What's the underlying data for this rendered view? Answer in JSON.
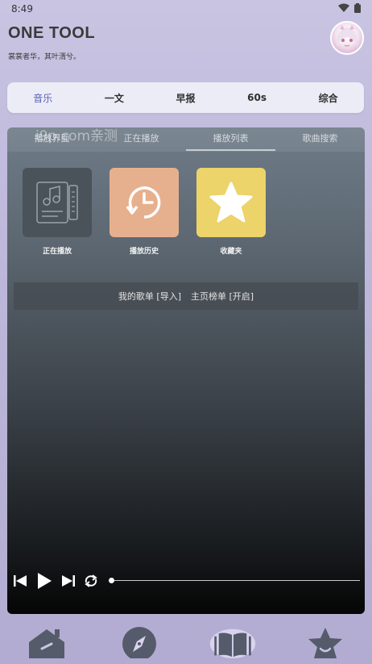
{
  "status": {
    "time": "8:49",
    "icons": [
      "wifi-icon",
      "battery-icon"
    ]
  },
  "header": {
    "title": "ONE TOOL",
    "subtitle": "裳裳者华，其叶湑兮。",
    "avatar_icon": "avatar-anime-girl"
  },
  "top_tabs": [
    {
      "label": "音乐",
      "active": true
    },
    {
      "label": "一文",
      "active": false
    },
    {
      "label": "早报",
      "active": false
    },
    {
      "label": "60s",
      "active": false
    },
    {
      "label": "综合",
      "active": false
    }
  ],
  "sub_tabs": [
    {
      "label": "播放界面",
      "active": false
    },
    {
      "label": "正在播放",
      "active": false
    },
    {
      "label": "播放列表",
      "active": true
    },
    {
      "label": "歌曲搜索",
      "active": false
    }
  ],
  "watermark": "i9p.com亲测",
  "tiles": [
    {
      "label": "正在播放",
      "icon": "playlist-note-icon",
      "color": "#4a525a"
    },
    {
      "label": "播放历史",
      "icon": "history-clock-icon",
      "color": "#e6b08e"
    },
    {
      "label": "收藏夹",
      "icon": "star-icon",
      "color": "#ecd36a"
    }
  ],
  "links": {
    "my_playlist": "我的歌单 [导入]",
    "home_chart": "主页榜单 [开启]"
  },
  "player_controls": {
    "progress": 0
  },
  "bottom_nav": [
    "home-icon",
    "compass-icon",
    "book-icon",
    "star-smile-icon"
  ]
}
